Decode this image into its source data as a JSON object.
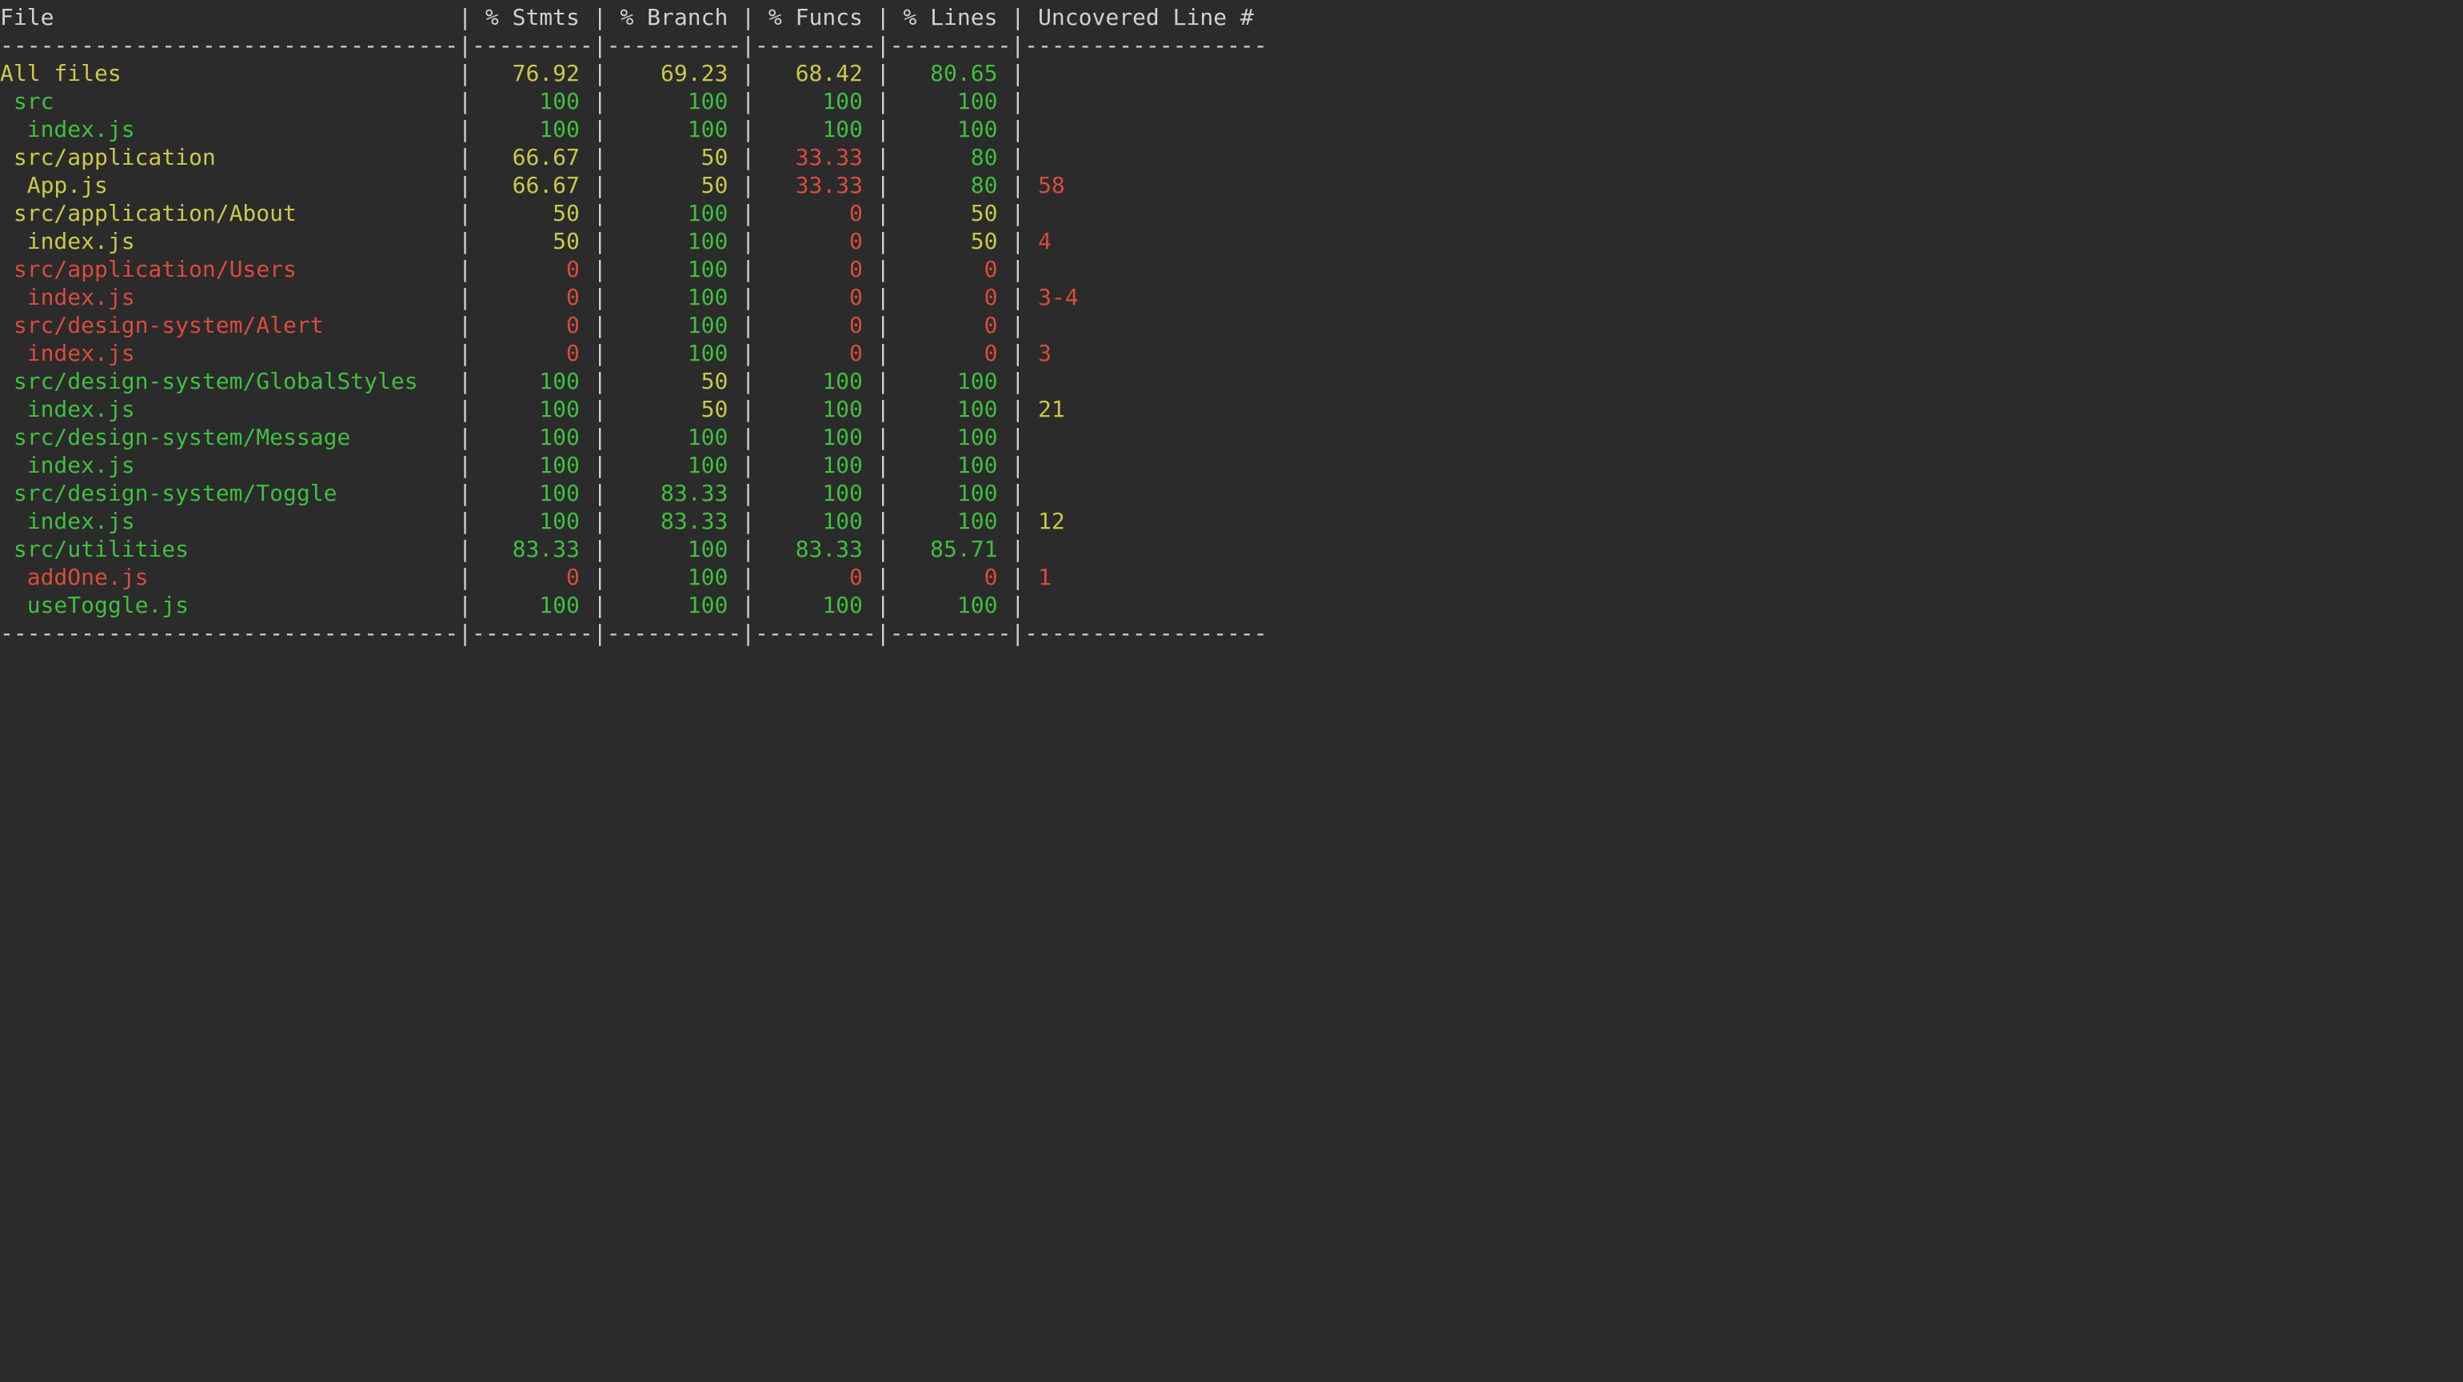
{
  "columns": {
    "file": {
      "label": "File",
      "width": 34
    },
    "stmts": {
      "label": "% Stmts",
      "width": 9
    },
    "branch": {
      "label": "% Branch",
      "width": 10
    },
    "funcs": {
      "label": "% Funcs",
      "width": 9
    },
    "lines": {
      "label": "% Lines",
      "width": 9
    },
    "uncovered": {
      "label": "Uncovered Line #",
      "width": 18
    }
  },
  "rows": [
    {
      "file": "All files",
      "indent": 0,
      "fileColor": "y",
      "stmts": "76.92",
      "stmtsColor": "y",
      "branch": "69.23",
      "branchColor": "y",
      "funcs": "68.42",
      "funcsColor": "y",
      "lines": "80.65",
      "linesColor": "g",
      "uncovered": "",
      "uncoveredColor": "w"
    },
    {
      "file": "src",
      "indent": 1,
      "fileColor": "g",
      "stmts": "100",
      "stmtsColor": "g",
      "branch": "100",
      "branchColor": "g",
      "funcs": "100",
      "funcsColor": "g",
      "lines": "100",
      "linesColor": "g",
      "uncovered": "",
      "uncoveredColor": "w"
    },
    {
      "file": "index.js",
      "indent": 2,
      "fileColor": "g",
      "stmts": "100",
      "stmtsColor": "g",
      "branch": "100",
      "branchColor": "g",
      "funcs": "100",
      "funcsColor": "g",
      "lines": "100",
      "linesColor": "g",
      "uncovered": "",
      "uncoveredColor": "w"
    },
    {
      "file": "src/application",
      "indent": 1,
      "fileColor": "y",
      "stmts": "66.67",
      "stmtsColor": "y",
      "branch": "50",
      "branchColor": "y",
      "funcs": "33.33",
      "funcsColor": "r",
      "lines": "80",
      "linesColor": "g",
      "uncovered": "",
      "uncoveredColor": "w"
    },
    {
      "file": "App.js",
      "indent": 2,
      "fileColor": "y",
      "stmts": "66.67",
      "stmtsColor": "y",
      "branch": "50",
      "branchColor": "y",
      "funcs": "33.33",
      "funcsColor": "r",
      "lines": "80",
      "linesColor": "g",
      "uncovered": "58",
      "uncoveredColor": "r"
    },
    {
      "file": "src/application/About",
      "indent": 1,
      "fileColor": "y",
      "stmts": "50",
      "stmtsColor": "y",
      "branch": "100",
      "branchColor": "g",
      "funcs": "0",
      "funcsColor": "r",
      "lines": "50",
      "linesColor": "y",
      "uncovered": "",
      "uncoveredColor": "w"
    },
    {
      "file": "index.js",
      "indent": 2,
      "fileColor": "y",
      "stmts": "50",
      "stmtsColor": "y",
      "branch": "100",
      "branchColor": "g",
      "funcs": "0",
      "funcsColor": "r",
      "lines": "50",
      "linesColor": "y",
      "uncovered": "4",
      "uncoveredColor": "r"
    },
    {
      "file": "src/application/Users",
      "indent": 1,
      "fileColor": "r",
      "stmts": "0",
      "stmtsColor": "r",
      "branch": "100",
      "branchColor": "g",
      "funcs": "0",
      "funcsColor": "r",
      "lines": "0",
      "linesColor": "r",
      "uncovered": "",
      "uncoveredColor": "w"
    },
    {
      "file": "index.js",
      "indent": 2,
      "fileColor": "r",
      "stmts": "0",
      "stmtsColor": "r",
      "branch": "100",
      "branchColor": "g",
      "funcs": "0",
      "funcsColor": "r",
      "lines": "0",
      "linesColor": "r",
      "uncovered": "3-4",
      "uncoveredColor": "r"
    },
    {
      "file": "src/design-system/Alert",
      "indent": 1,
      "fileColor": "r",
      "stmts": "0",
      "stmtsColor": "r",
      "branch": "100",
      "branchColor": "g",
      "funcs": "0",
      "funcsColor": "r",
      "lines": "0",
      "linesColor": "r",
      "uncovered": "",
      "uncoveredColor": "w"
    },
    {
      "file": "index.js",
      "indent": 2,
      "fileColor": "r",
      "stmts": "0",
      "stmtsColor": "r",
      "branch": "100",
      "branchColor": "g",
      "funcs": "0",
      "funcsColor": "r",
      "lines": "0",
      "linesColor": "r",
      "uncovered": "3",
      "uncoveredColor": "r"
    },
    {
      "file": "src/design-system/GlobalStyles",
      "indent": 1,
      "fileColor": "g",
      "stmts": "100",
      "stmtsColor": "g",
      "branch": "50",
      "branchColor": "y",
      "funcs": "100",
      "funcsColor": "g",
      "lines": "100",
      "linesColor": "g",
      "uncovered": "",
      "uncoveredColor": "w"
    },
    {
      "file": "index.js",
      "indent": 2,
      "fileColor": "g",
      "stmts": "100",
      "stmtsColor": "g",
      "branch": "50",
      "branchColor": "y",
      "funcs": "100",
      "funcsColor": "g",
      "lines": "100",
      "linesColor": "g",
      "uncovered": "21",
      "uncoveredColor": "y"
    },
    {
      "file": "src/design-system/Message",
      "indent": 1,
      "fileColor": "g",
      "stmts": "100",
      "stmtsColor": "g",
      "branch": "100",
      "branchColor": "g",
      "funcs": "100",
      "funcsColor": "g",
      "lines": "100",
      "linesColor": "g",
      "uncovered": "",
      "uncoveredColor": "w"
    },
    {
      "file": "index.js",
      "indent": 2,
      "fileColor": "g",
      "stmts": "100",
      "stmtsColor": "g",
      "branch": "100",
      "branchColor": "g",
      "funcs": "100",
      "funcsColor": "g",
      "lines": "100",
      "linesColor": "g",
      "uncovered": "",
      "uncoveredColor": "w"
    },
    {
      "file": "src/design-system/Toggle",
      "indent": 1,
      "fileColor": "g",
      "stmts": "100",
      "stmtsColor": "g",
      "branch": "83.33",
      "branchColor": "g",
      "funcs": "100",
      "funcsColor": "g",
      "lines": "100",
      "linesColor": "g",
      "uncovered": "",
      "uncoveredColor": "w"
    },
    {
      "file": "index.js",
      "indent": 2,
      "fileColor": "g",
      "stmts": "100",
      "stmtsColor": "g",
      "branch": "83.33",
      "branchColor": "g",
      "funcs": "100",
      "funcsColor": "g",
      "lines": "100",
      "linesColor": "g",
      "uncovered": "12",
      "uncoveredColor": "y"
    },
    {
      "file": "src/utilities",
      "indent": 1,
      "fileColor": "g",
      "stmts": "83.33",
      "stmtsColor": "g",
      "branch": "100",
      "branchColor": "g",
      "funcs": "83.33",
      "funcsColor": "g",
      "lines": "85.71",
      "linesColor": "g",
      "uncovered": "",
      "uncoveredColor": "w"
    },
    {
      "file": "addOne.js",
      "indent": 2,
      "fileColor": "r",
      "stmts": "0",
      "stmtsColor": "r",
      "branch": "100",
      "branchColor": "g",
      "funcs": "0",
      "funcsColor": "r",
      "lines": "0",
      "linesColor": "r",
      "uncovered": "1",
      "uncoveredColor": "r"
    },
    {
      "file": "useToggle.js",
      "indent": 2,
      "fileColor": "g",
      "stmts": "100",
      "stmtsColor": "g",
      "branch": "100",
      "branchColor": "g",
      "funcs": "100",
      "funcsColor": "g",
      "lines": "100",
      "linesColor": "g",
      "uncovered": "",
      "uncoveredColor": "w"
    }
  ]
}
